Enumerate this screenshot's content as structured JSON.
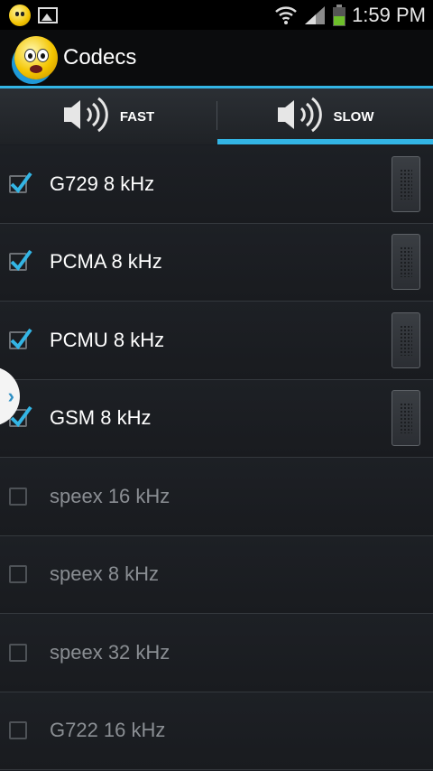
{
  "status_bar": {
    "time": "1:59 PM",
    "left_icons": [
      "app-notification-icon",
      "picture-icon"
    ],
    "right_icons": [
      "wifi-icon",
      "signal-icon",
      "battery-icon"
    ]
  },
  "action_bar": {
    "title": "Codecs",
    "icon": "app-emoji-icon",
    "accent_color": "#33b5e5"
  },
  "tabs": [
    {
      "label": "FAST",
      "icon": "speaker-icon",
      "selected": false
    },
    {
      "label": "SLOW",
      "icon": "speaker-icon",
      "selected": true
    }
  ],
  "codecs": [
    {
      "label": "G729 8 kHz",
      "checked": true
    },
    {
      "label": "PCMA 8 kHz",
      "checked": true
    },
    {
      "label": "PCMU 8 kHz",
      "checked": true
    },
    {
      "label": "GSM 8 kHz",
      "checked": true
    },
    {
      "label": "speex 16 kHz",
      "checked": false
    },
    {
      "label": "speex 8 kHz",
      "checked": false
    },
    {
      "label": "speex 32 kHz",
      "checked": false
    },
    {
      "label": "G722 16 kHz",
      "checked": false
    }
  ],
  "side_tab": {
    "glyph": "›"
  }
}
